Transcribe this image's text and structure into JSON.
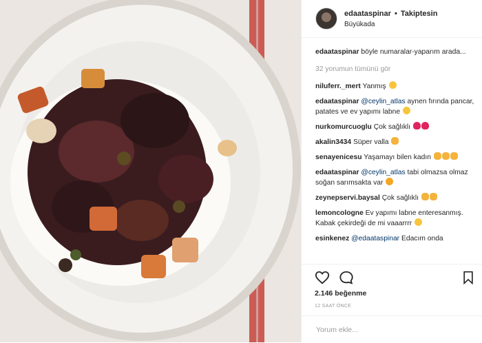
{
  "post": {
    "username": "edaataspinar",
    "separator": "•",
    "follow_label": "Takiptesin",
    "location": "Büyükada"
  },
  "caption": {
    "username": "edaataspinar",
    "text": "böyle numaralar-yaparım arada..."
  },
  "view_all_comments": "32 yorumun tümünü gör",
  "comments": [
    {
      "username": "niluferr._mert",
      "text": "Yanmış",
      "emoji": "smile"
    },
    {
      "username": "edaataspinar",
      "mention": "@ceylin_atlas",
      "text": "aynen fırında pancar, patates ve ev yapımı labne",
      "emoji": "smile"
    },
    {
      "username": "nurkomurcuoglu",
      "text": "Çok sağlıklı",
      "emoji": "hearts"
    },
    {
      "username": "akalin3434",
      "text": "Süper valla",
      "emoji": "hand"
    },
    {
      "username": "senayenicesu",
      "text": "Yaşamayı bilen kadın",
      "emoji": "hands"
    },
    {
      "username": "edaataspinar",
      "mention": "@ceylin_atlas",
      "text": "tabi olmazsa olmaz soğan sarımsakta var",
      "emoji": "laugh"
    },
    {
      "username": "zeynepservi.baysal",
      "text": "Çok sağlıklı",
      "emoji": "hands"
    },
    {
      "username": "lemoncologne",
      "text": "Ev yapımı labne enteresanmış. Kabak çekirdeği de mi vaaarrrr",
      "emoji": "smile"
    },
    {
      "username": "esinkenez",
      "mention": "@edaataspinar",
      "text": "Edacım onda",
      "emoji": ""
    }
  ],
  "likes": "2.146 beğenme",
  "timestamp": "12 SAAT ÖNCE",
  "comment_input": {
    "placeholder": "Yorum ekle..."
  },
  "icons": {
    "like": "heart-outline-icon",
    "comment": "speech-bubble-icon",
    "save": "bookmark-icon"
  },
  "colors": {
    "mention": "#003569",
    "text": "#262626",
    "muted": "#999999"
  }
}
